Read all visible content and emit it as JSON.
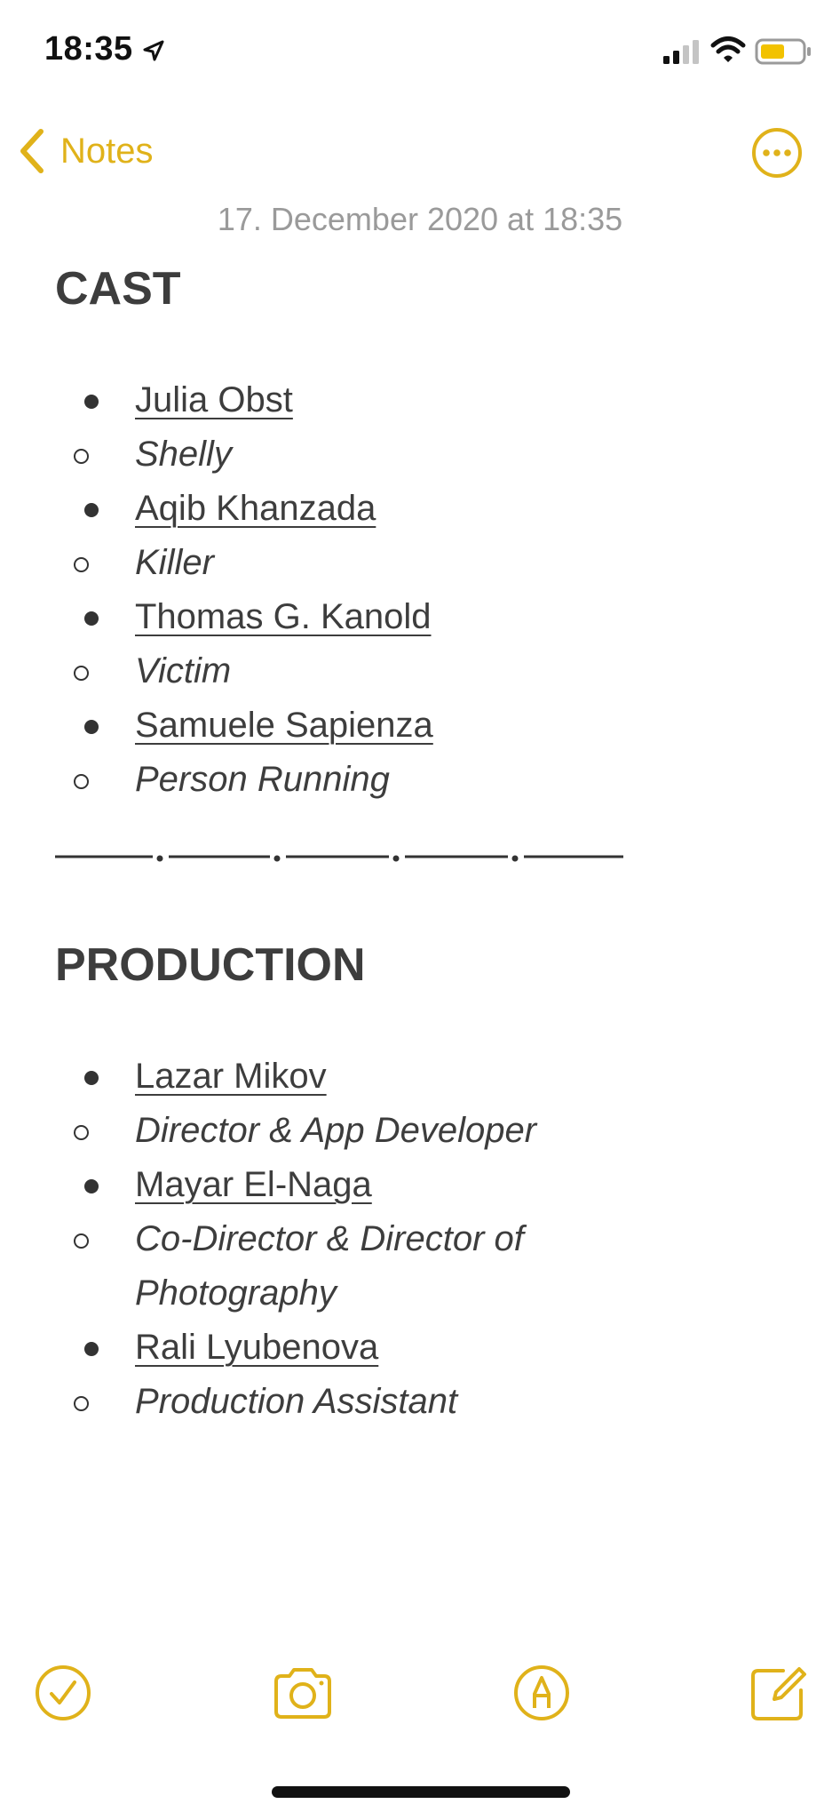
{
  "status": {
    "time": "18:35"
  },
  "nav": {
    "back_label": "Notes"
  },
  "note": {
    "date": "17. December 2020 at 18:35",
    "cast": {
      "heading": "CAST",
      "people": [
        {
          "name": "Julia Obst",
          "role": "Shelly"
        },
        {
          "name": "Aqib Khanzada",
          "role": "Killer"
        },
        {
          "name": "Thomas G. Kanold",
          "role": "Victim"
        },
        {
          "name": "Samuele Sapienza",
          "role": "Person Running"
        }
      ]
    },
    "production": {
      "heading": "PRODUCTION",
      "people": [
        {
          "name": "Lazar Mikov",
          "role": "Director & App Developer"
        },
        {
          "name": "Mayar El-Naga",
          "role_line1": "Co-Director & Director of",
          "role_line2": "Photography"
        },
        {
          "name": "Rali Lyubenova",
          "role": "Production Assistant"
        }
      ]
    }
  },
  "icons": {
    "back": "chevron-left-icon",
    "more": "ellipsis-circle-icon",
    "checklist": "checkmark-circle-icon",
    "camera": "camera-icon",
    "markup": "pen-circle-icon",
    "compose": "compose-icon"
  },
  "colors": {
    "accent": "#e0b21a",
    "text": "#3d3d3d",
    "date": "#9a9a9a",
    "spell": "#e53935"
  }
}
